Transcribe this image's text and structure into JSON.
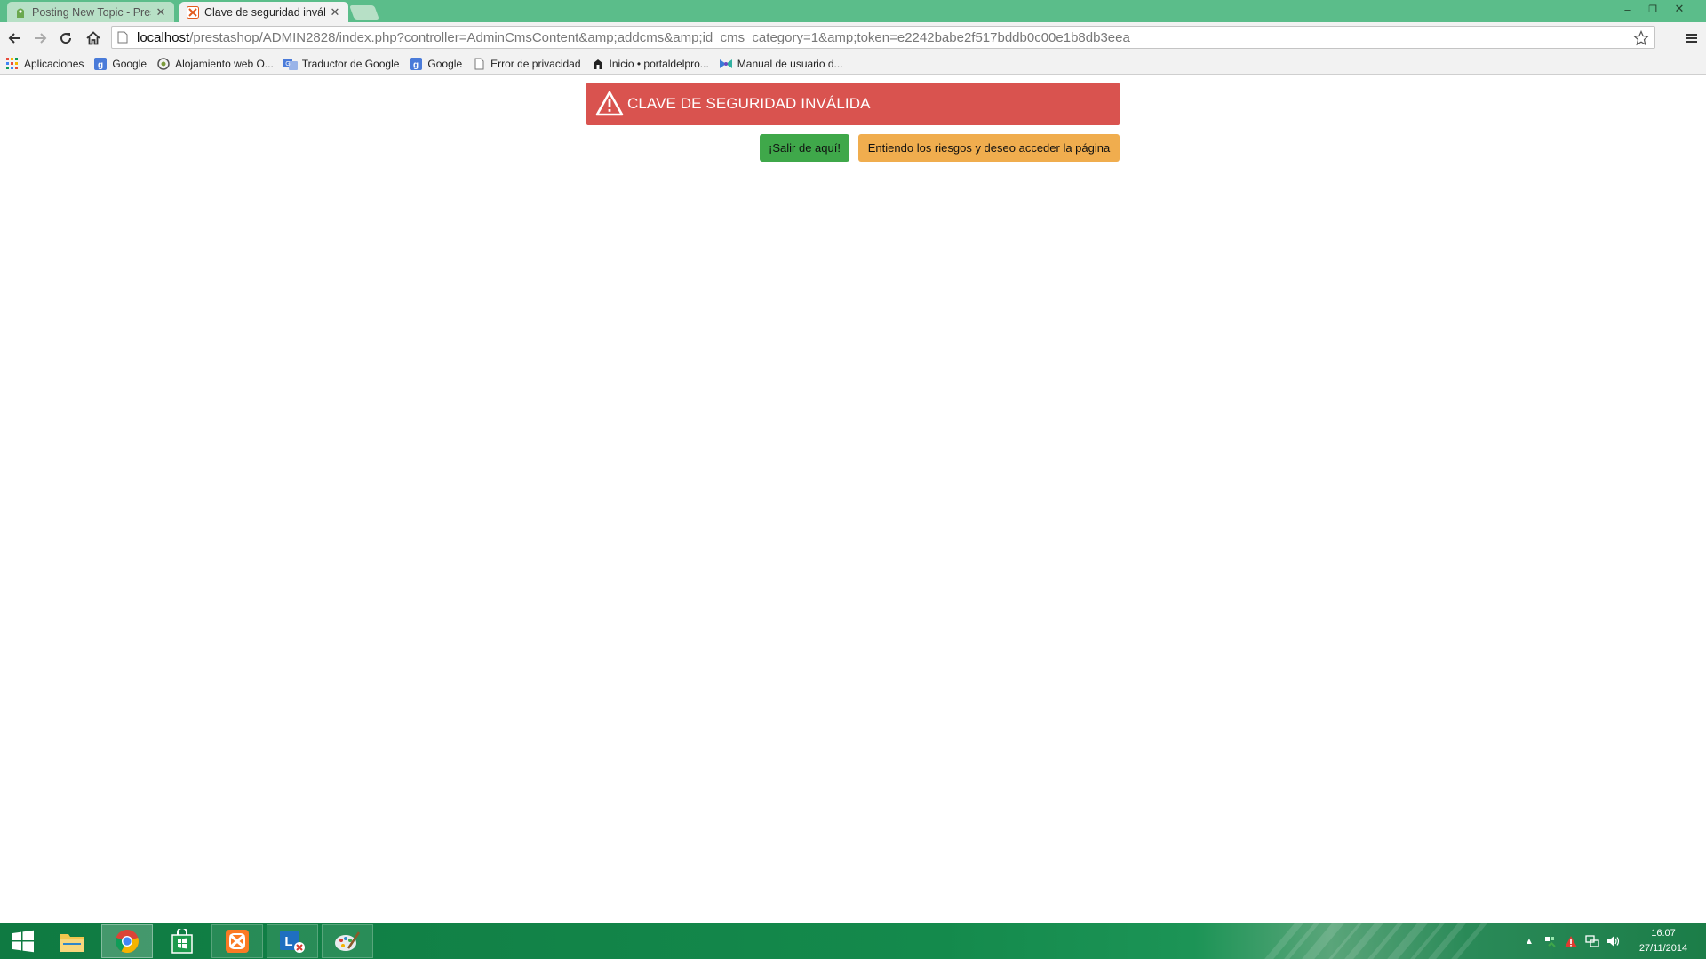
{
  "browser": {
    "tabs": [
      {
        "title": "Posting New Topic - Presta",
        "active": false
      },
      {
        "title": "Clave de seguridad inválid",
        "active": true
      }
    ],
    "window_controls": {
      "minimize": "–",
      "restore": "❐",
      "close": "✕"
    },
    "address": {
      "host": "localhost",
      "path": "/prestashop/ADMIN2828/index.php?controller=AdminCmsContent&amp;addcms&amp;id_cms_category=1&amp;token=e2242babe2f517bddb0c00e1b8db3eea"
    },
    "bookmarks": [
      {
        "label": "Aplicaciones",
        "icon": "apps-grid-icon"
      },
      {
        "label": "Google",
        "icon": "google-icon"
      },
      {
        "label": "Alojamiento web O...",
        "icon": "hosting-icon"
      },
      {
        "label": "Traductor de Google",
        "icon": "translate-icon"
      },
      {
        "label": "Google",
        "icon": "google-icon"
      },
      {
        "label": "Error de privacidad",
        "icon": "page-icon"
      },
      {
        "label": "Inicio • portaldelpro...",
        "icon": "portal-icon"
      },
      {
        "label": "Manual de usuario d...",
        "icon": "manual-icon"
      }
    ]
  },
  "page": {
    "alert_text": "CLAVE DE SEGURIDAD INVÁLIDA",
    "exit_button": "¡Salir de aquí!",
    "proceed_button": "Entiendo los riesgos y deseo acceder la página",
    "colors": {
      "alert": "#d9534f",
      "exit": "#3fa84a",
      "proceed": "#f0ad4e"
    }
  },
  "taskbar": {
    "apps": [
      "start",
      "file-explorer",
      "chrome",
      "store",
      "xampp",
      "lync",
      "paint"
    ],
    "time": "16:07",
    "date": "27/11/2014"
  }
}
